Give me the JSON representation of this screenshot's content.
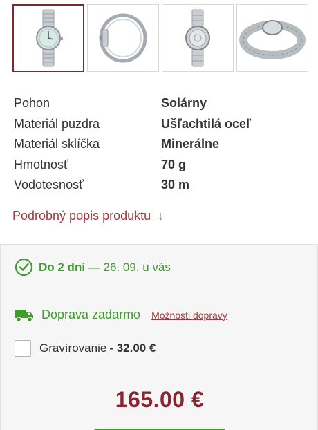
{
  "thumbnails": [
    {
      "icon": "watch-front-icon",
      "active": true
    },
    {
      "icon": "watch-side-icon",
      "active": false
    },
    {
      "icon": "watch-back-icon",
      "active": false
    },
    {
      "icon": "watch-bracelet-icon",
      "active": false
    }
  ],
  "specs": [
    {
      "label": "Pohon",
      "value": "Solárny"
    },
    {
      "label": "Materiál puzdra",
      "value": "Ušľachtilá oceľ"
    },
    {
      "label": "Materiál sklíčka",
      "value": "Minerálne"
    },
    {
      "label": "Hmotnosť",
      "value": "70 g"
    },
    {
      "label": "Vodotesnosť",
      "value": "30 m"
    }
  ],
  "detail_link": {
    "label": "Podrobný popis produktu",
    "arrow": "↓"
  },
  "delivery": {
    "bold": "Do 2 dní",
    "rest": " — 26. 09. u vás",
    "icon": "check-circle-icon"
  },
  "shipping": {
    "label": "Doprava zadarmo",
    "link": "Možnosti dopravy",
    "icon": "truck-icon"
  },
  "engraving": {
    "label": "Gravírovanie",
    "price": "- 32.00 €",
    "checked": false
  },
  "price": "165.00 €",
  "colors": {
    "accent": "#8a2430",
    "link": "#9e3a3a",
    "green": "#3f9b2f"
  }
}
